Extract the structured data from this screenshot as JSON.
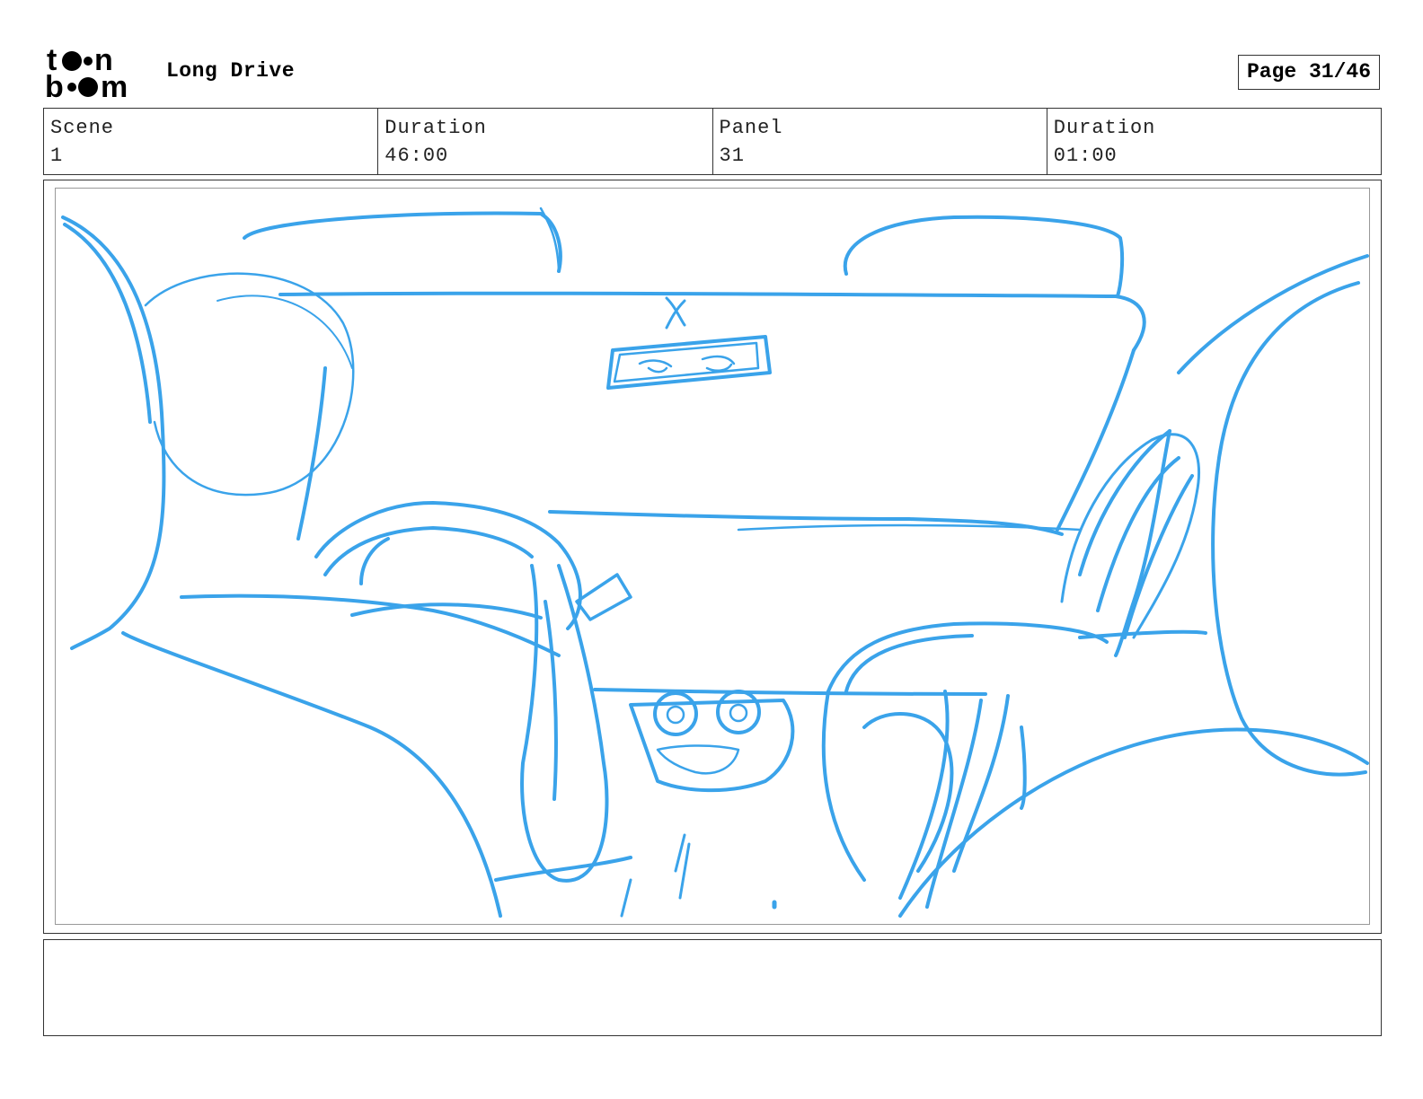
{
  "header": {
    "logo_icon": "toonboom-logo-icon",
    "logo_text_line1": "t n",
    "logo_text_line2": "b m",
    "project_title": "Long Drive",
    "page_label": "Page 31/46"
  },
  "info": {
    "scene_label": "Scene",
    "scene_value": "1",
    "scene_duration_label": "Duration",
    "scene_duration_value": "46:00",
    "panel_label": "Panel",
    "panel_value": "31",
    "panel_duration_label": "Duration",
    "panel_duration_value": "01:00"
  },
  "panel": {
    "sketch_icon": "car-interior-sketch-icon",
    "stroke_color": "#3aa3ea"
  },
  "notes": {
    "text": ""
  }
}
